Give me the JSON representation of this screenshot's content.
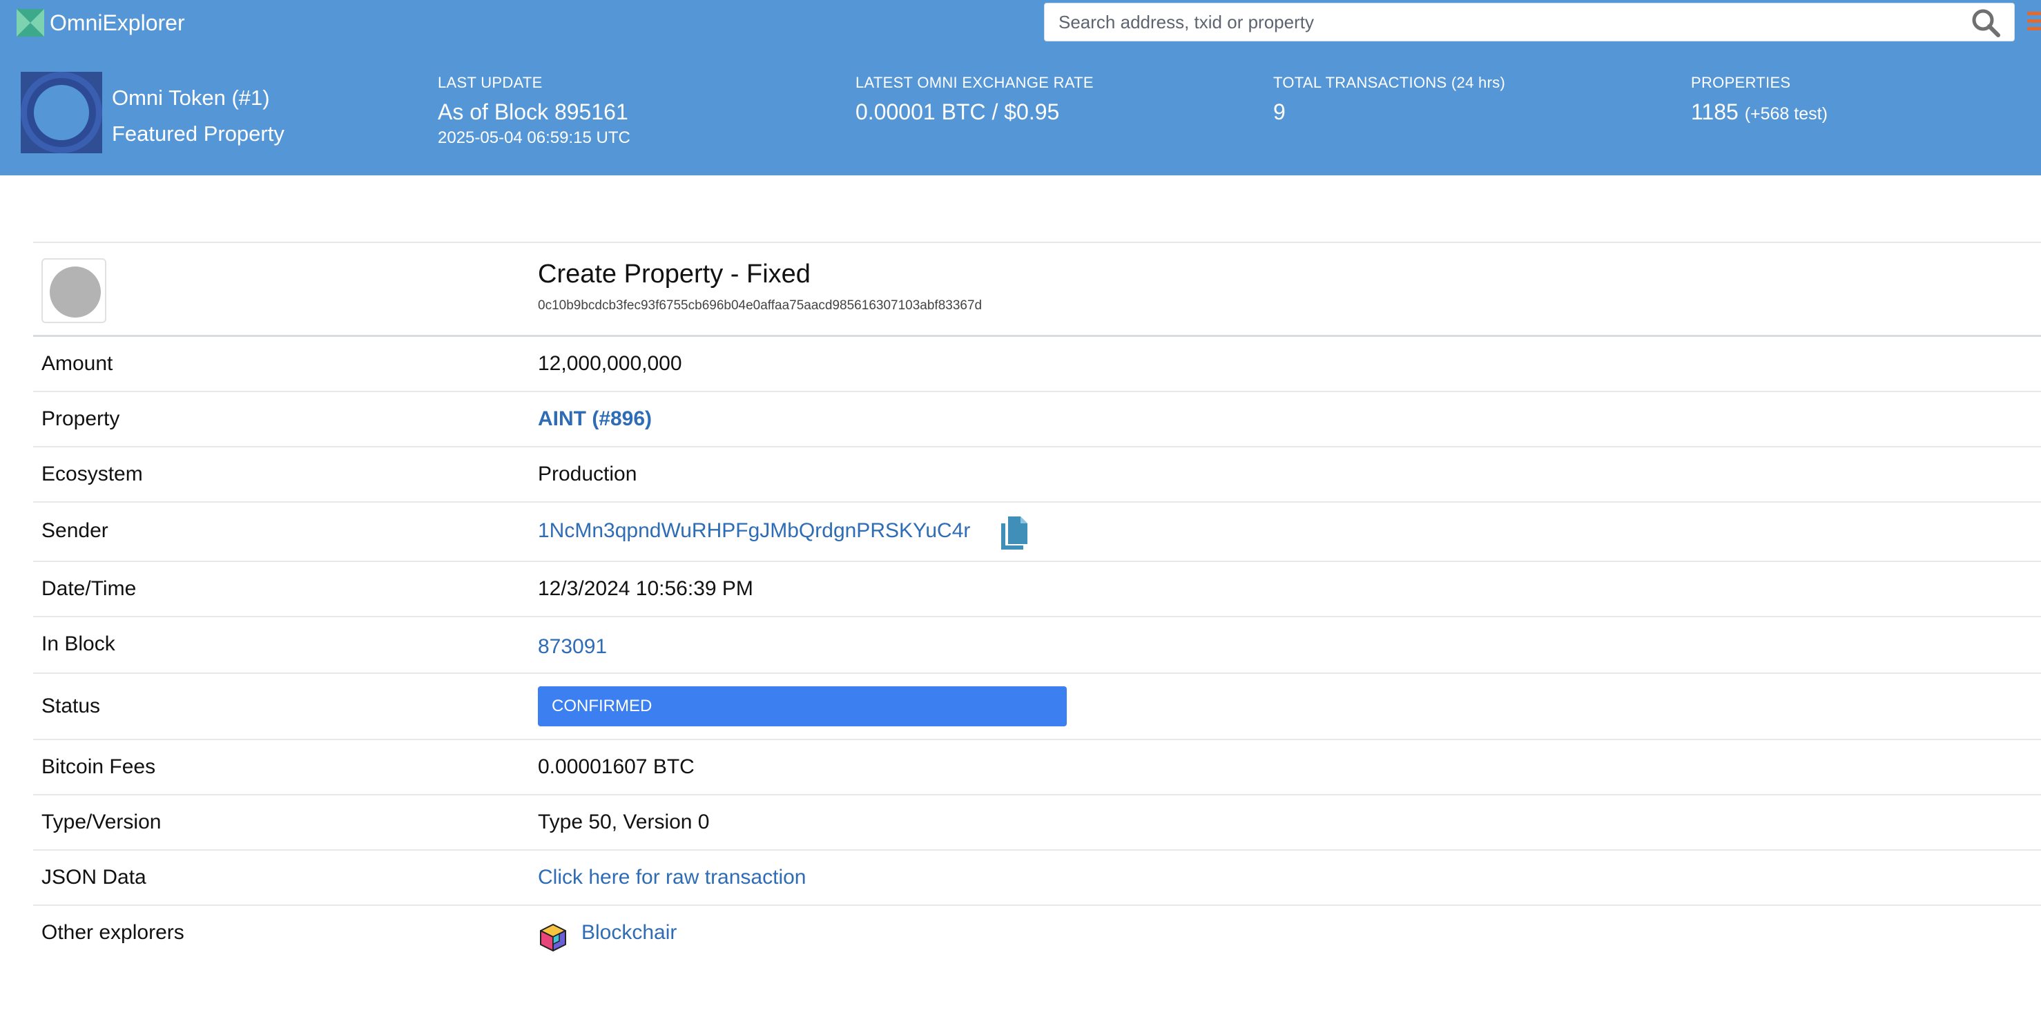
{
  "header": {
    "brand": "OmniExplorer",
    "search": {
      "placeholder": "Search address, txid or property",
      "value": ""
    },
    "featured": {
      "line1": "Omni Token (#1)",
      "line2": "Featured Property"
    },
    "stats": {
      "last_update": {
        "label": "LAST UPDATE",
        "value": "As of Block 895161",
        "sub": "2025-05-04 06:59:15 UTC"
      },
      "exchange_rate": {
        "label": "LATEST OMNI EXCHANGE RATE",
        "value": "0.00001 BTC / $0.95"
      },
      "total_tx": {
        "label": "TOTAL TRANSACTIONS (24 hrs)",
        "value": "9"
      },
      "properties": {
        "label": "PROPERTIES",
        "value": "1185",
        "suffix": "(+568 test)"
      }
    }
  },
  "transaction": {
    "title": "Create Property - Fixed",
    "txid": "0c10b9bcdcb3fec93f6755cb696b04e0affaa75aacd985616307103abf83367d"
  },
  "details": {
    "amount": {
      "label": "Amount",
      "value": "12,000,000,000"
    },
    "property": {
      "label": "Property",
      "value": "AINT (#896)"
    },
    "ecosystem": {
      "label": "Ecosystem",
      "value": "Production"
    },
    "sender": {
      "label": "Sender",
      "value": "1NcMn3qpndWuRHPFgJMbQrdgnPRSKYuC4r"
    },
    "datetime": {
      "label": "Date/Time",
      "value": "12/3/2024 10:56:39 PM"
    },
    "in_block": {
      "label": "In Block",
      "value": "873091"
    },
    "status": {
      "label": "Status",
      "value": "CONFIRMED"
    },
    "fees": {
      "label": "Bitcoin Fees",
      "value": "0.00001607 BTC"
    },
    "type_version": {
      "label": "Type/Version",
      "value": "Type 50, Version 0"
    },
    "json_data": {
      "label": "JSON Data",
      "value": "Click here for raw transaction"
    },
    "other_explorers": {
      "label": "Other explorers",
      "value": "Blockchair"
    }
  },
  "icons": {
    "brand_logo": "omni-logo-icon",
    "search": "search-icon",
    "menu": "hamburger-menu-icon",
    "featured": "omni-token-icon",
    "copy": "copy-icon",
    "blockchair": "blockchair-cube-icon"
  },
  "colors": {
    "header_bg": "#5597d6",
    "link": "#2e6cb5",
    "status_confirmed": "#3b7ff0",
    "copy_icon": "#3f8fb8"
  }
}
